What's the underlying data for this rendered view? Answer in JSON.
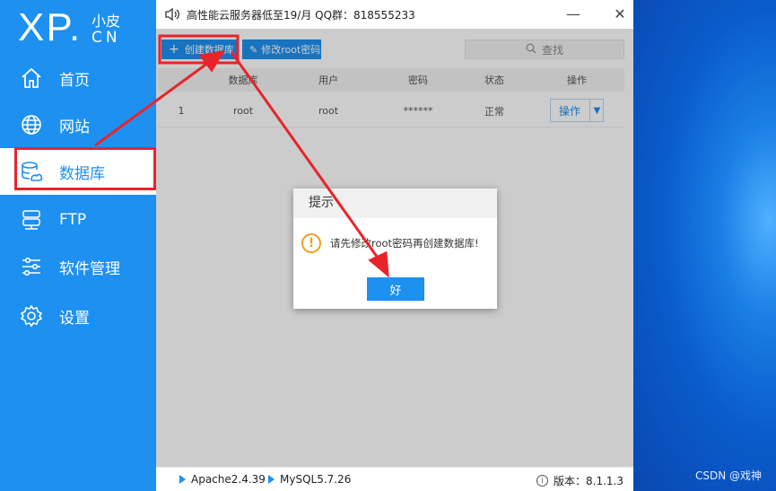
{
  "logo": {
    "brand": "XP.",
    "small": "小皮",
    "cn": "CN"
  },
  "sidebar": {
    "items": [
      {
        "label": "首页",
        "icon": "home-icon"
      },
      {
        "label": "网站",
        "icon": "globe-icon"
      },
      {
        "label": "数据库",
        "icon": "database-icon"
      },
      {
        "label": "FTP",
        "icon": "ftp-server-icon"
      },
      {
        "label": "软件管理",
        "icon": "sliders-icon"
      },
      {
        "label": "设置",
        "icon": "gear-icon"
      }
    ],
    "active_index": 2
  },
  "titlebar": {
    "notice": "高性能云服务器低至19/月  QQ群：818555233",
    "minimize": "—",
    "close": "✕"
  },
  "toolbar": {
    "create_db": "创建数据库",
    "change_pwd": "修改root密码",
    "search_placeholder": "查找"
  },
  "table": {
    "headers": [
      "数据库",
      "用户",
      "密码",
      "状态",
      "操作"
    ],
    "rows": [
      {
        "index": "1",
        "database": "root",
        "user": "root",
        "password": "******",
        "status": "正常",
        "action": "操作"
      }
    ]
  },
  "dialog": {
    "title": "提示",
    "message": "请先修改root密码再创建数据库!",
    "ok": "好"
  },
  "statusbar": {
    "apache": "Apache2.4.39",
    "mysql": "MySQL5.7.26",
    "version": "版本：8.1.1.3"
  },
  "watermark": "CSDN @戏神",
  "colors": {
    "accent": "#1e90f0",
    "annotation": "#e8242b",
    "warning": "#f0a020"
  }
}
